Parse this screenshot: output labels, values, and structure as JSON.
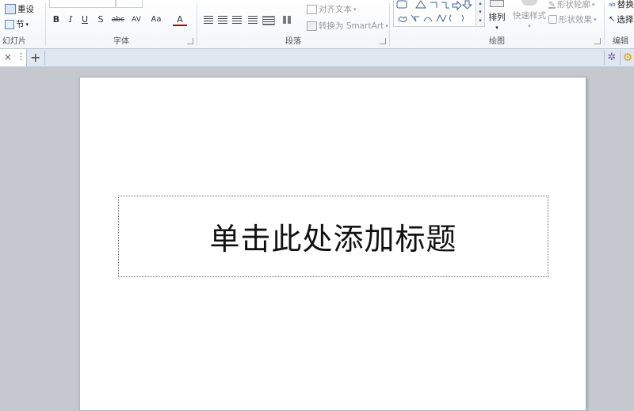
{
  "ribbon": {
    "slides_group": {
      "label": "幻灯片",
      "reset": "重设",
      "section": "节"
    },
    "font_group": {
      "label": "字体",
      "bold": "B",
      "italic": "I",
      "underline": "U",
      "shadow": "S",
      "strike": "abc",
      "spacing": "AV",
      "case": "Aa",
      "color": "A"
    },
    "paragraph_group": {
      "label": "段落",
      "align_text": "对齐文本",
      "convert_smartart": "转换为 SmartArt"
    },
    "drawing_group": {
      "label": "绘图",
      "arrange": "排列",
      "quick_styles": "快速样式",
      "shape_outline": "形状轮廓",
      "shape_effects": "形状效果"
    },
    "editing_group": {
      "label": "编辑",
      "replace": "替换",
      "select": "选择"
    }
  },
  "tabbar": {
    "close": "×",
    "more": "⋮",
    "add": "+"
  },
  "slide": {
    "title_placeholder": "单击此处添加标题"
  }
}
